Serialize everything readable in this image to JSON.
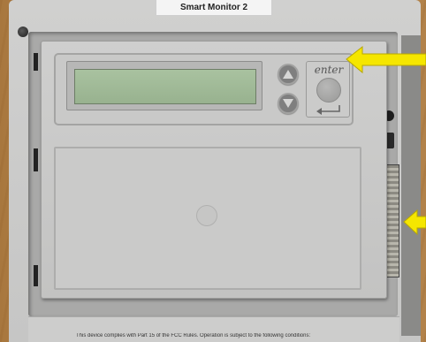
{
  "device": {
    "label_text": "Smart Monitor 2",
    "enter_label": "enter",
    "fcc_notice": "This device complies with Part 15 of the FCC Rules. Operation is subject to the following conditions:"
  },
  "icons": {
    "up": "triangle-up-icon",
    "down": "triangle-down-icon",
    "enter": "return-arrow-icon",
    "callout": "yellow-arrow-icon"
  },
  "colors": {
    "lcd": "#a9c2a0",
    "housing": "#c9c9c8",
    "arrow_highlight": "#f5e600",
    "wood": "#b9894e"
  }
}
